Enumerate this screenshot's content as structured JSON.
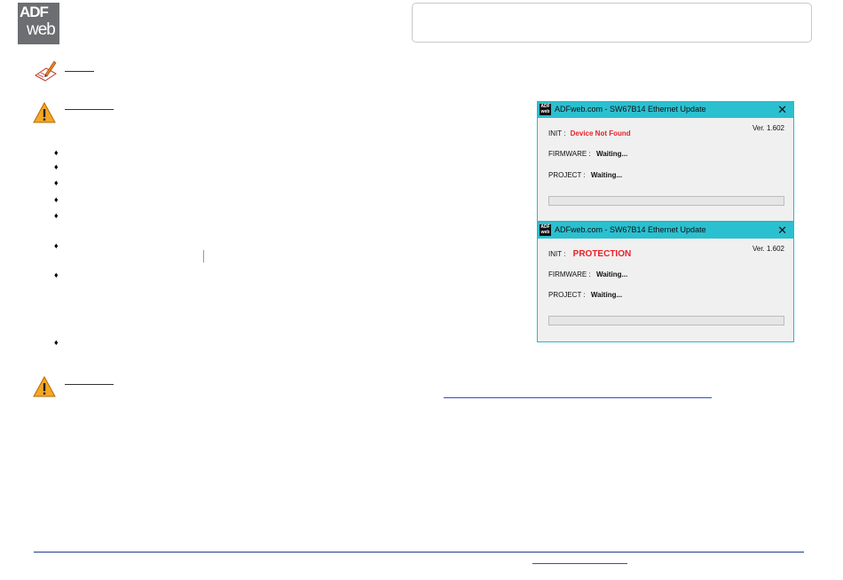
{
  "header": {
    "logo_top": "ADF",
    "logo_bottom": "web"
  },
  "dialogs": [
    {
      "app_icon": "ADF web",
      "title": "ADFweb.com - SW67B14 Ethernet Update",
      "close": "✕",
      "version": "Ver. 1.602",
      "init_label": "INIT :",
      "init_value": "Device Not Found",
      "firmware_label": "FIRMWARE :",
      "firmware_value": "Waiting...",
      "project_label": "PROJECT :",
      "project_value": "Waiting..."
    },
    {
      "app_icon": "ADF web",
      "title": "ADFweb.com - SW67B14 Ethernet Update",
      "close": "✕",
      "version": "Ver. 1.602",
      "init_label": "INIT :",
      "init_value": "PROTECTION",
      "firmware_label": "FIRMWARE :",
      "firmware_value": "Waiting...",
      "project_label": "PROJECT :",
      "project_value": "Waiting..."
    }
  ],
  "bullets": [
    "♦",
    "♦",
    "♦",
    "♦",
    "♦",
    "♦",
    "♦",
    "♦"
  ],
  "colors": {
    "accent": "#2bc0d0",
    "error": "#e8222a",
    "link": "#2a4bd7",
    "warning": "#f5a623"
  }
}
